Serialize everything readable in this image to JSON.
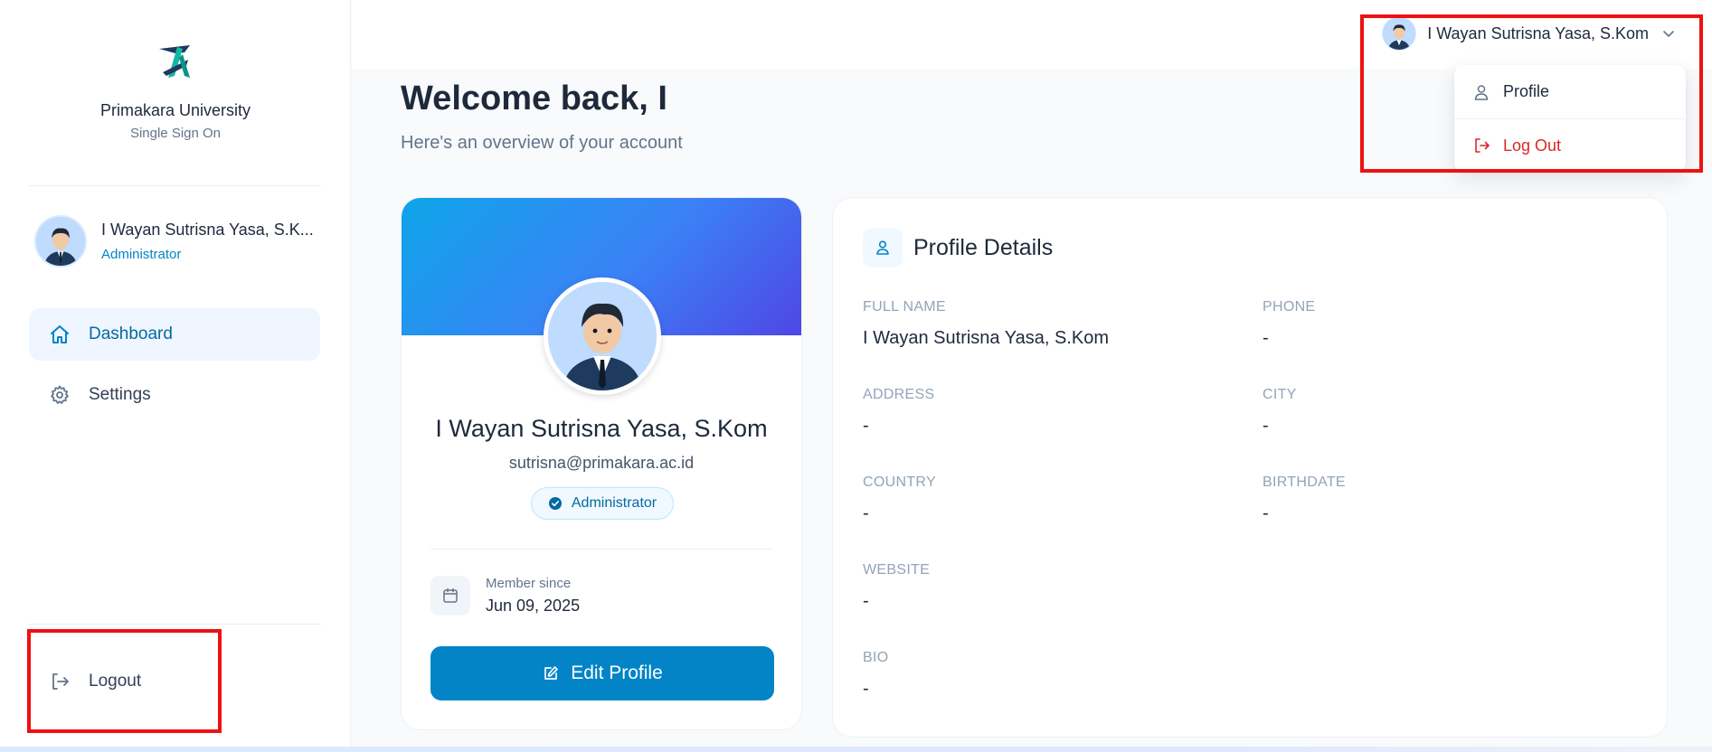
{
  "brand": {
    "name": "Primakara University",
    "subtitle": "Single Sign On"
  },
  "sidebar": {
    "user": {
      "name": "I Wayan Sutrisna Yasa, S.K...",
      "role": "Administrator"
    },
    "items": [
      {
        "label": "Dashboard",
        "icon": "home-icon",
        "active": true
      },
      {
        "label": "Settings",
        "icon": "gear-icon",
        "active": false
      }
    ],
    "logout_label": "Logout"
  },
  "topbar": {
    "user_name": "I Wayan Sutrisna Yasa, S.Kom",
    "dropdown": [
      {
        "label": "Profile",
        "icon": "user-icon"
      },
      {
        "label": "Log Out",
        "icon": "logout-icon",
        "color": "#dc2626"
      }
    ]
  },
  "main": {
    "welcome_title": "Welcome back, I",
    "welcome_subtitle": "Here's an overview of your account",
    "profile_card": {
      "name": "I Wayan Sutrisna Yasa, S.Kom",
      "email": "sutrisna@primakara.ac.id",
      "badge": "Administrator",
      "member_since_label": "Member since",
      "member_since_date": "Jun 09, 2025",
      "edit_button": "Edit Profile"
    },
    "details": {
      "title": "Profile Details",
      "fields": {
        "full_name": {
          "label": "FULL NAME",
          "value": "I Wayan Sutrisna Yasa, S.Kom"
        },
        "phone": {
          "label": "PHONE",
          "value": "-"
        },
        "address": {
          "label": "ADDRESS",
          "value": "-"
        },
        "city": {
          "label": "CITY",
          "value": "-"
        },
        "country": {
          "label": "COUNTRY",
          "value": "-"
        },
        "birthdate": {
          "label": "BIRTHDATE",
          "value": "-"
        },
        "website": {
          "label": "WEBSITE",
          "value": "-"
        },
        "bio": {
          "label": "BIO",
          "value": "-"
        }
      }
    }
  },
  "colors": {
    "accent": "#0284c7",
    "danger": "#dc2626",
    "highlight": "#ee1111",
    "gradient_start": "#0ea5e9",
    "gradient_end": "#4f46e5"
  }
}
